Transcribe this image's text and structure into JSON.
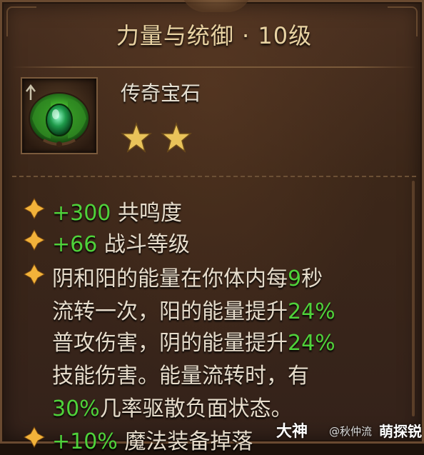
{
  "title": "力量与统御 · 10级",
  "gem": {
    "icon": "green-gem-icon",
    "name": "传奇宝石",
    "stars": 2,
    "max_stars": 2
  },
  "stats": [
    {
      "value": "+300",
      "label": " 共鸣度"
    },
    {
      "value": "+66",
      "label": " 战斗等级"
    }
  ],
  "effect": {
    "line1_pre": "阴和阳的能量在你体内每",
    "line1_num": "9",
    "line1_post": "秒",
    "line2_pre": "流转一次，阳的能量提升",
    "line2_num": "24%",
    "line3_pre": "普攻伤害，阴的能量提升",
    "line3_num": "24%",
    "line4": "技能伤害。能量流转时，有",
    "line5_num": "30%",
    "line5_post": "几率驱散负面状态。"
  },
  "partial_stat": {
    "value": "+10%",
    "label": " 魔法装备掉落"
  },
  "watermark": {
    "logo": "大神",
    "handle": "@秋仲流",
    "site": "萌探锐"
  },
  "colors": {
    "highlight": "#4fd23a",
    "text": "#e6dccb",
    "title": "#e8d2a2",
    "bullet": "#f2b23a"
  }
}
